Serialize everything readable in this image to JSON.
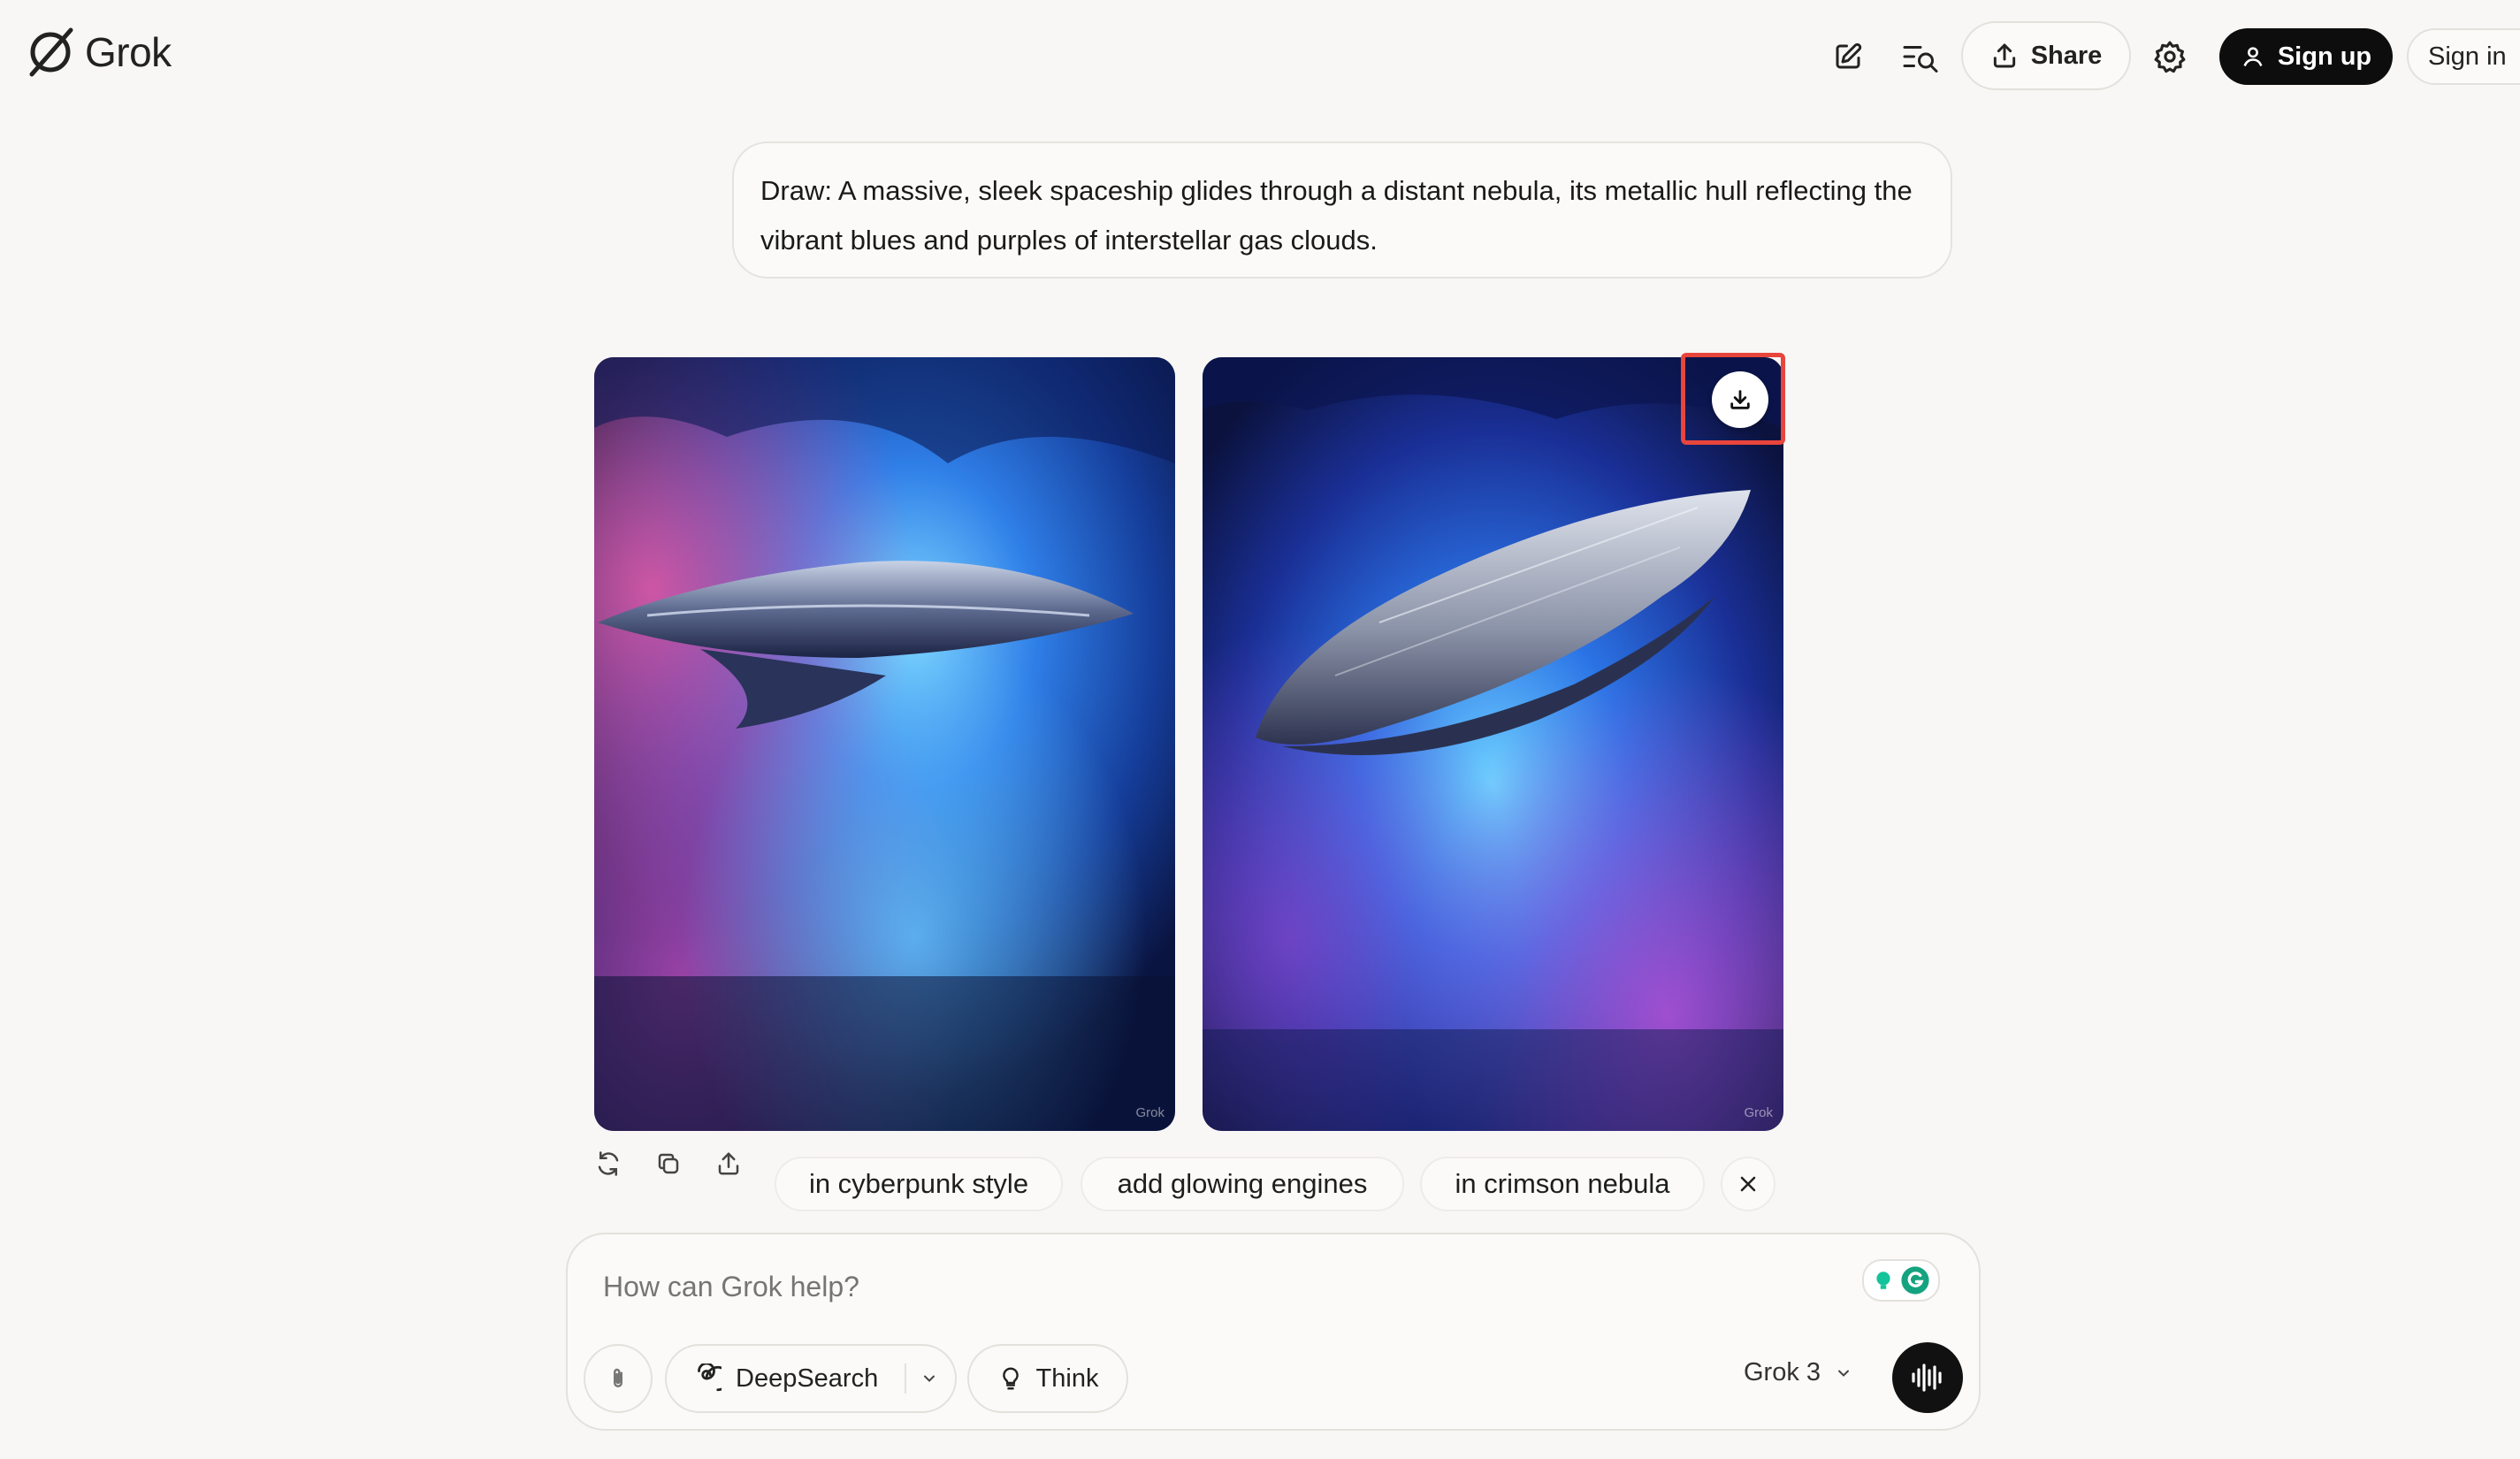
{
  "header": {
    "logo_text": "Grok",
    "share_label": "Share",
    "signup_label": "Sign up",
    "signin_label": "Sign in"
  },
  "conversation": {
    "user_prompt": "Draw: A massive, sleek spaceship glides through a distant nebula, its metallic hull reflecting the vibrant blues and purples of interstellar gas clouds.",
    "images": [
      {
        "alt": "Spaceship in blue nebula with pink clouds",
        "watermark": "Grok"
      },
      {
        "alt": "Silver spaceship in blue and purple nebula",
        "watermark": "Grok"
      }
    ]
  },
  "suggestions": [
    "in cyberpunk style",
    "add glowing engines",
    "in crimson nebula"
  ],
  "composer": {
    "placeholder": "How can Grok help?",
    "deepsearch_label": "DeepSearch",
    "think_label": "Think",
    "model_label": "Grok 3"
  },
  "colors": {
    "background": "#f8f7f5",
    "highlight": "#e8453c",
    "primary_button": "#0d0d0d"
  }
}
